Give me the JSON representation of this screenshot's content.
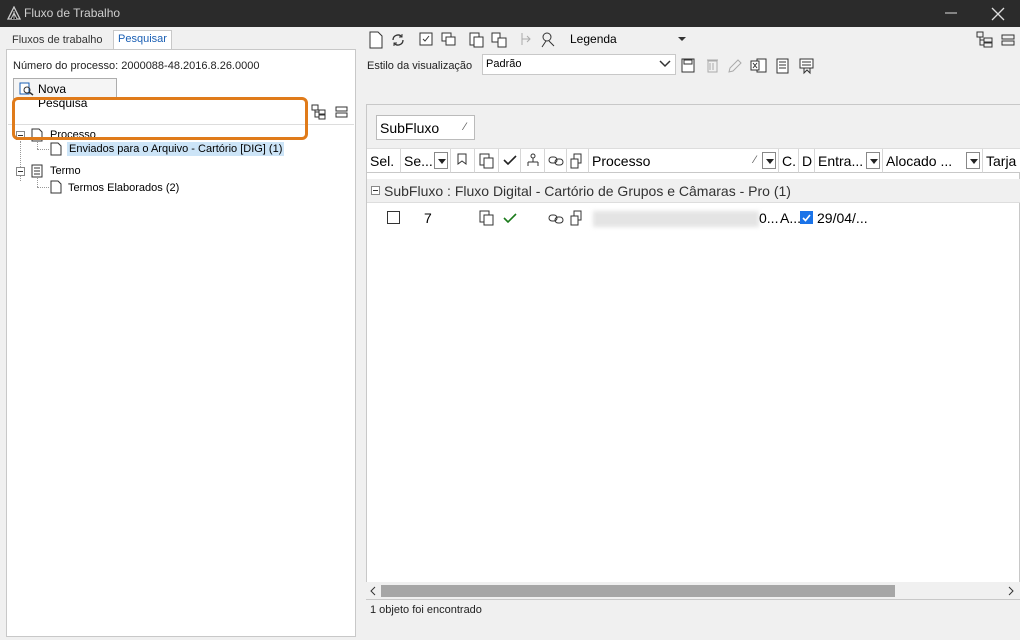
{
  "window": {
    "title": "Fluxo de Trabalho"
  },
  "left": {
    "tabs": [
      {
        "label": "Fluxos de trabalho",
        "active": false
      },
      {
        "label": "Pesquisar",
        "active": true
      }
    ],
    "process_number_label": "Número do processo: 2000088-48.2016.8.26.0000",
    "nova_pesquisa_label": "Nova Pesquisa",
    "tree": {
      "processo_label": "Processo",
      "processo_child": "Enviados para o Arquivo - Cartório [DIG] (1)",
      "termo_label": "Termo",
      "termo_child": "Termos Elaborados (2)"
    }
  },
  "right": {
    "toolbar": {
      "legenda_label": "Legenda"
    },
    "estilo_label": "Estilo da visualização",
    "estilo_value": "Padrão",
    "group_chip": "SubFluxo",
    "columns": [
      "Sel.",
      "Se...",
      "Processo",
      "C.",
      "D",
      "Entra...",
      "Alocado ...",
      "Tarja"
    ],
    "group_row_label": "SubFluxo : Fluxo Digital - Cartório de Grupos e Câmaras - Pro  (1)",
    "row": {
      "seq": "7",
      "processo_tail": "0...",
      "c": "A...",
      "entrada": "29/04/..."
    },
    "status": "1 objeto foi encontrado"
  },
  "colors": {
    "titlebar": "#2b2b2b",
    "highlight": "#e07b1a",
    "selection": "#cce4f7",
    "check": "#1a7a1a"
  }
}
